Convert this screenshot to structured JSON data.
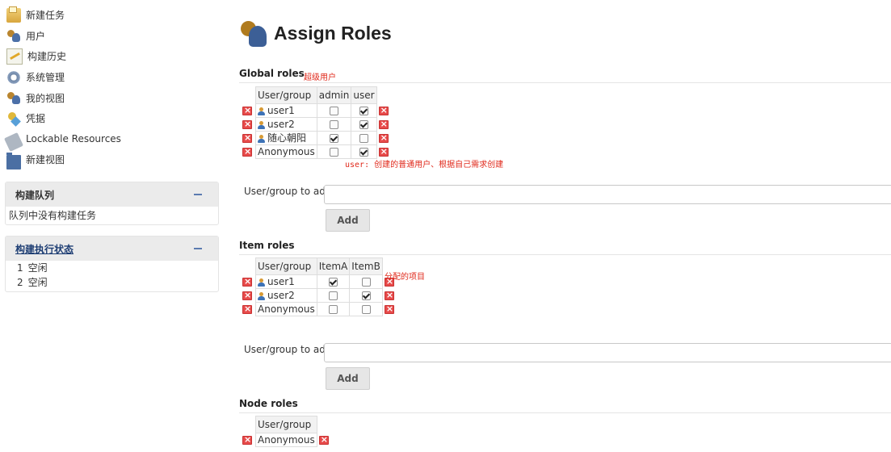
{
  "sidebar": {
    "tasks": [
      {
        "label": "新建任务",
        "icon": "new-item-icon"
      },
      {
        "label": "用户",
        "icon": "people-icon"
      },
      {
        "label": "构建历史",
        "icon": "build-history-icon"
      },
      {
        "label": "系统管理",
        "icon": "gear-icon"
      },
      {
        "label": "我的视图",
        "icon": "people-icon"
      },
      {
        "label": "凭据",
        "icon": "credentials-icon"
      },
      {
        "label": "Lockable Resources",
        "icon": "lock-icon"
      },
      {
        "label": "新建视图",
        "icon": "folder-icon"
      }
    ],
    "build_queue": {
      "title": "构建队列",
      "empty_text": "队列中没有构建任务"
    },
    "executors": {
      "title": "构建执行状态",
      "rows": [
        {
          "num": "1",
          "status": "空闲"
        },
        {
          "num": "2",
          "status": "空闲"
        }
      ]
    }
  },
  "main": {
    "title": "Assign Roles",
    "global": {
      "heading": "Global roles",
      "note_super": "超级用户",
      "note_user": "user: 创建的普通用户、根据自己需求创建",
      "columns": [
        "User/group",
        "admin",
        "user"
      ],
      "rows": [
        {
          "name": "user1",
          "is_user": true,
          "checks": [
            false,
            true
          ]
        },
        {
          "name": "user2",
          "is_user": true,
          "checks": [
            false,
            true
          ]
        },
        {
          "name": "随心朝阳",
          "is_user": true,
          "checks": [
            true,
            false
          ]
        },
        {
          "name": "Anonymous",
          "is_user": false,
          "checks": [
            false,
            true
          ]
        }
      ]
    },
    "item": {
      "heading": "Item roles",
      "note": "分配的项目",
      "columns": [
        "User/group",
        "ItemA",
        "ItemB"
      ],
      "rows": [
        {
          "name": "user1",
          "is_user": true,
          "checks": [
            true,
            false
          ]
        },
        {
          "name": "user2",
          "is_user": true,
          "checks": [
            false,
            true
          ]
        },
        {
          "name": "Anonymous",
          "is_user": false,
          "checks": [
            false,
            false
          ]
        }
      ]
    },
    "node": {
      "heading": "Node roles",
      "columns": [
        "User/group"
      ],
      "rows": [
        {
          "name": "Anonymous",
          "is_user": false,
          "checks": []
        }
      ]
    },
    "add": {
      "label": "User/group to add",
      "button": "Add"
    }
  }
}
